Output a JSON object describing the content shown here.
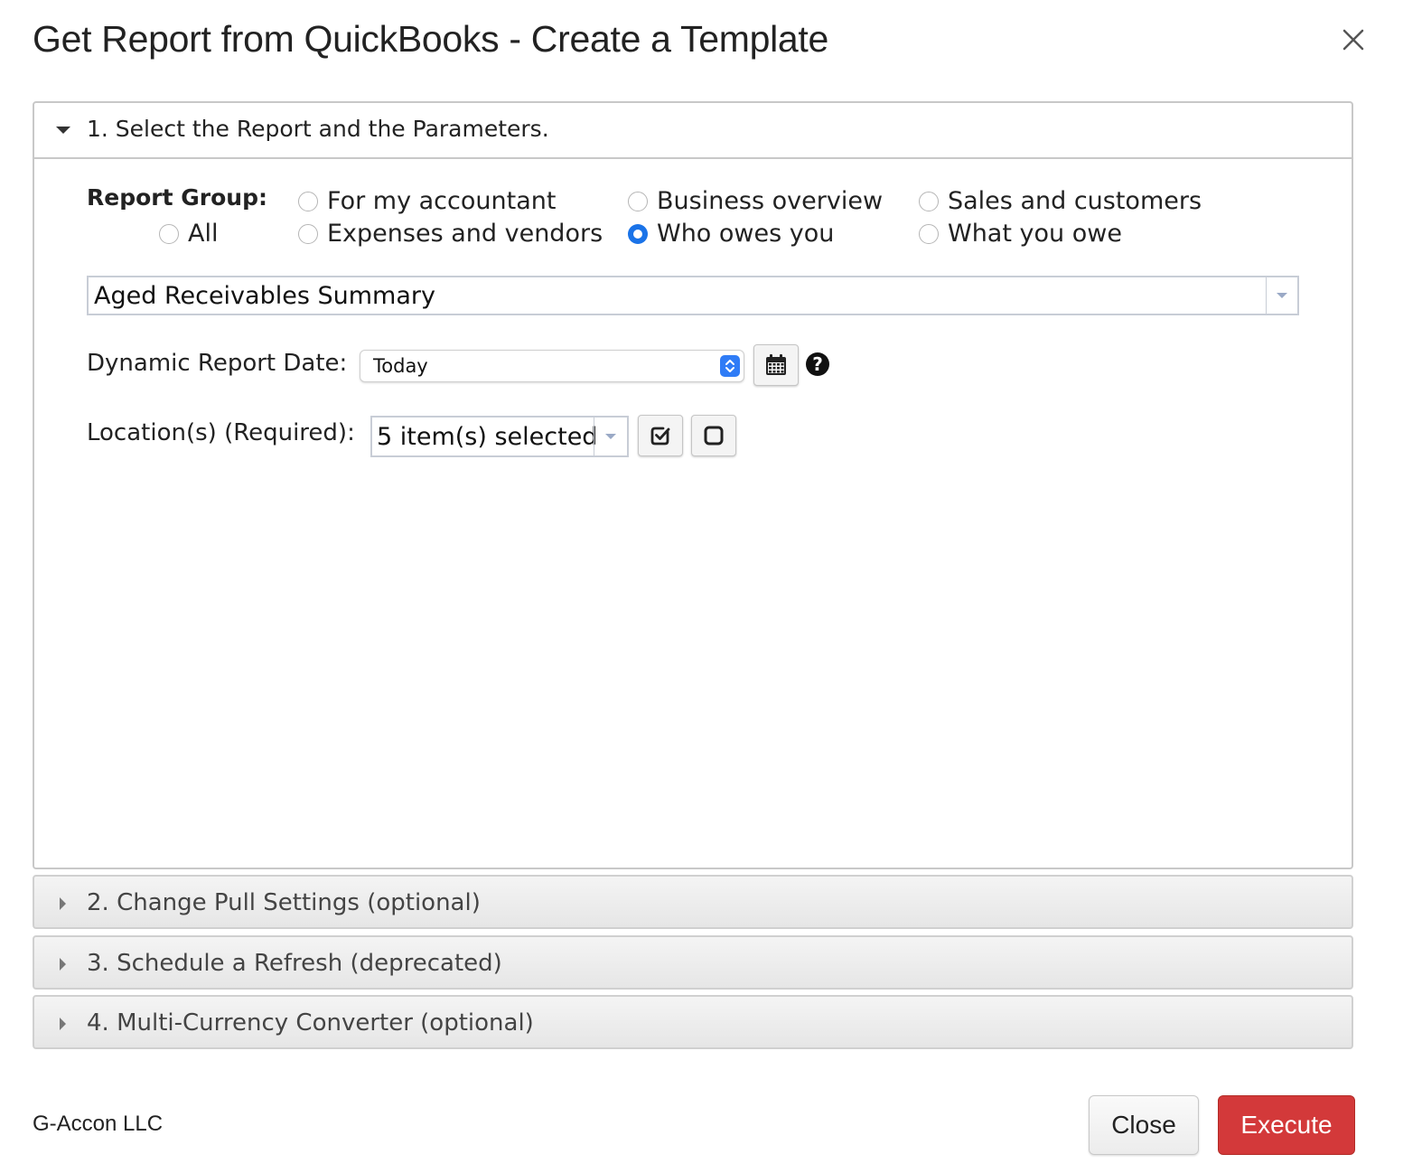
{
  "dialog": {
    "title": "Get Report from QuickBooks - Create a Template",
    "close_icon": "close-icon"
  },
  "section1": {
    "label": "1. Select the Report and the Parameters.",
    "report_group": {
      "label": "Report Group:",
      "options": [
        {
          "label": "For my accountant",
          "checked": false
        },
        {
          "label": "Business overview",
          "checked": false
        },
        {
          "label": "Sales and customers",
          "checked": false
        },
        {
          "label": "All",
          "checked": false
        },
        {
          "label": "Expenses and vendors",
          "checked": false
        },
        {
          "label": "Who owes you",
          "checked": true
        },
        {
          "label": "What you owe",
          "checked": false
        }
      ]
    },
    "report_select": {
      "value": "Aged Receivables Summary"
    },
    "dynamic_date": {
      "label": "Dynamic Report Date:",
      "value": "Today"
    },
    "locations": {
      "label": "Location(s) (Required):",
      "value": "5 item(s) selected"
    },
    "help_icon_glyph": "?"
  },
  "sections": [
    {
      "label": "2. Change Pull Settings (optional)"
    },
    {
      "label": "3. Schedule a Refresh (deprecated)"
    },
    {
      "label": "4. Multi-Currency Converter (optional)"
    }
  ],
  "footer": {
    "company": "G-Accon LLC",
    "close_label": "Close",
    "execute_label": "Execute"
  },
  "colors": {
    "accent_blue": "#1a73e8",
    "execute_red": "#d3393a"
  }
}
